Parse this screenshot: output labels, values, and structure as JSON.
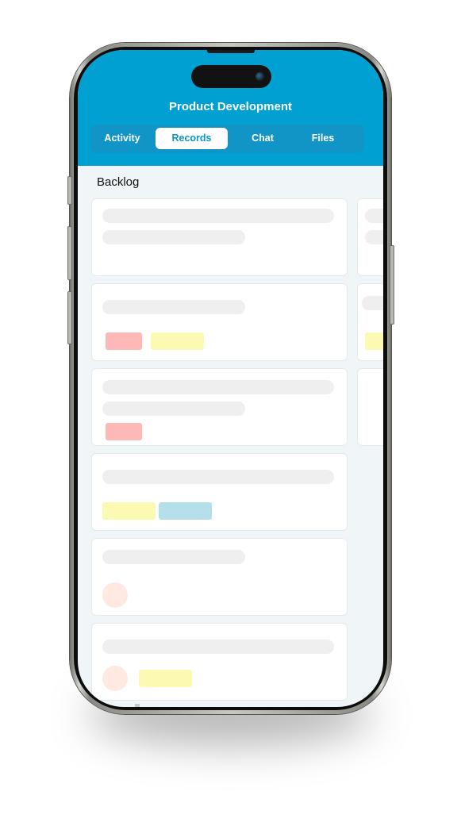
{
  "app": {
    "title": "Product Development"
  },
  "tabs": [
    {
      "label": "Activity",
      "active": false
    },
    {
      "label": "Records",
      "active": true
    },
    {
      "label": "Chat",
      "active": false
    },
    {
      "label": "Files",
      "active": false
    }
  ],
  "board": {
    "column_title": "Backlog",
    "colors": {
      "header": "#00a0d2",
      "tag_red": "#ffb8b8",
      "tag_yellow": "#fcf9b3",
      "tag_blue": "#b6e0e9",
      "avatar": "#ffe9e0",
      "skeleton": "#efefef"
    },
    "cards": [
      {
        "skeleton_lines": [
          "long",
          "short"
        ],
        "tags": [],
        "avatar": false
      },
      {
        "skeleton_lines": [
          "short"
        ],
        "tags": [
          "red",
          "yellow"
        ],
        "avatar": false
      },
      {
        "skeleton_lines": [
          "long",
          "short"
        ],
        "tags": [
          "red"
        ],
        "avatar": false
      },
      {
        "skeleton_lines": [
          "long"
        ],
        "tags": [
          "yellow",
          "blue"
        ],
        "avatar": false
      },
      {
        "skeleton_lines": [
          "short"
        ],
        "tags": [],
        "avatar": true
      },
      {
        "skeleton_lines": [
          "long"
        ],
        "tags": [
          "yellow"
        ],
        "avatar": true
      }
    ],
    "next_column_cards": [
      {
        "skeleton_lines": [
          "long",
          "long"
        ],
        "tags": []
      },
      {
        "skeleton_lines": [
          "long"
        ],
        "tags": [
          "yellow"
        ]
      },
      {
        "skeleton_lines": [],
        "tags": []
      }
    ]
  }
}
